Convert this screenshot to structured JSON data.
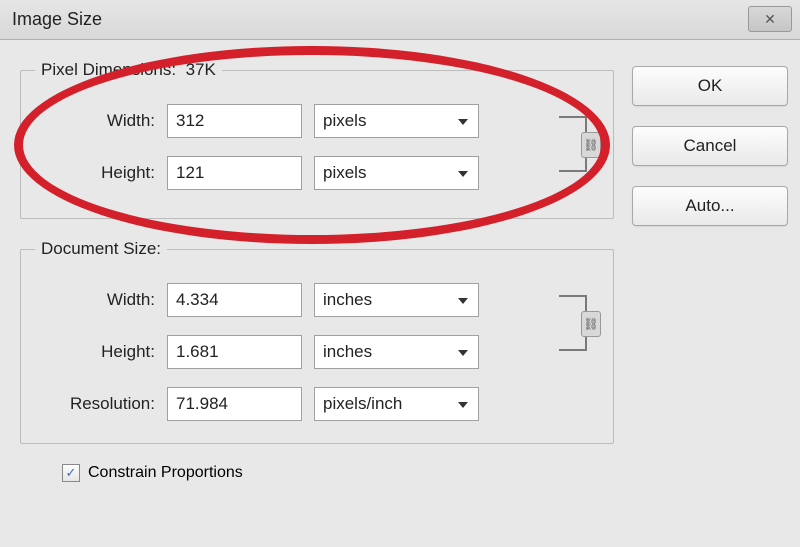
{
  "title": "Image Size",
  "closeGlyph": "✕",
  "buttons": {
    "ok": "OK",
    "cancel": "Cancel",
    "auto": "Auto..."
  },
  "pixelDimensions": {
    "legendPrefix": "Pixel Dimensions:",
    "sizeText": "37K",
    "widthLabel": "Width:",
    "widthValue": "312",
    "widthUnit": "pixels",
    "heightLabel": "Height:",
    "heightValue": "121",
    "heightUnit": "pixels"
  },
  "documentSize": {
    "legend": "Document Size:",
    "widthLabel": "Width:",
    "widthValue": "4.334",
    "widthUnit": "inches",
    "heightLabel": "Height:",
    "heightValue": "1.681",
    "heightUnit": "inches",
    "resolutionLabel": "Resolution:",
    "resolutionValue": "71.984",
    "resolutionUnit": "pixels/inch"
  },
  "constrain": {
    "label": "Constrain Proportions",
    "checked": true
  },
  "linkGlyph": "⛓"
}
